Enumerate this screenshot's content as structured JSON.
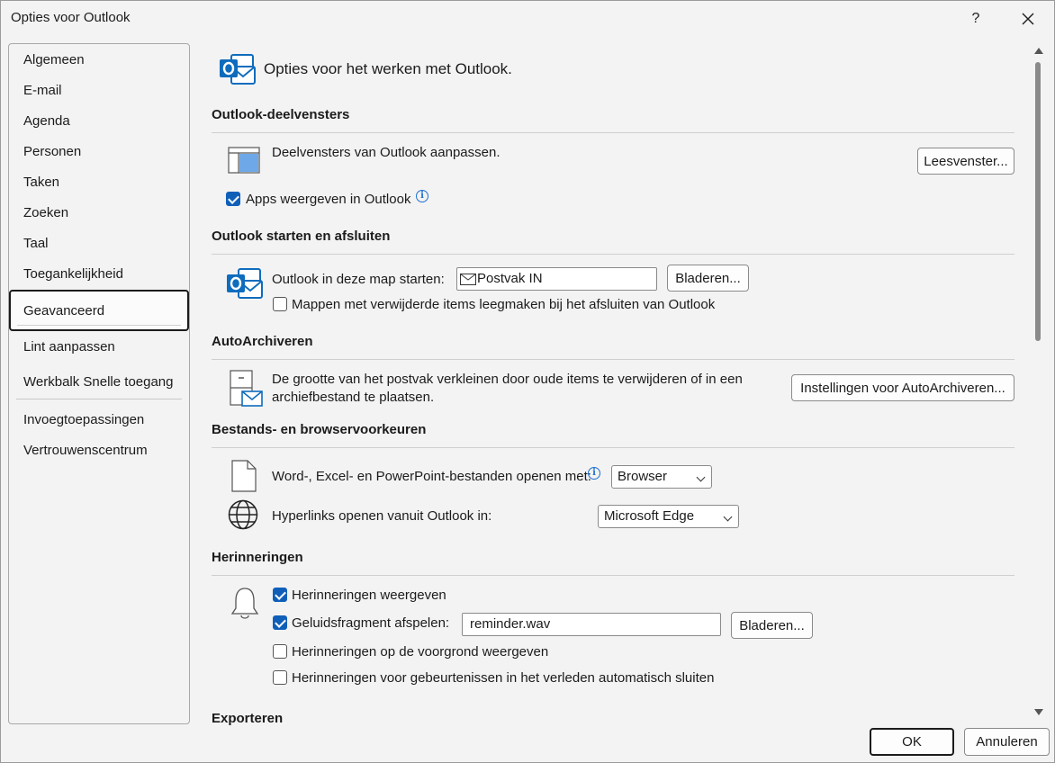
{
  "window": {
    "title": "Opties voor Outlook",
    "help": "?"
  },
  "sidebar": {
    "items": [
      "Algemeen",
      "E-mail",
      "Agenda",
      "Personen",
      "Taken",
      "Zoeken",
      "Taal",
      "Toegankelijkheid",
      "Geavanceerd",
      "Lint aanpassen",
      "Werkbalk Snelle toegang",
      "Invoegtoepassingen",
      "Vertrouwenscentrum"
    ],
    "selected": "Geavanceerd"
  },
  "header": {
    "text": "Opties voor het werken met Outlook."
  },
  "sections": {
    "panes": {
      "title": "Outlook-deelvensters",
      "description": "Deelvensters van Outlook aanpassen.",
      "button": "Leesvenster...",
      "apps_checkbox": "Apps weergeven in Outlook",
      "apps_checked": true
    },
    "start": {
      "title": "Outlook starten en afsluiten",
      "folder_label": "Outlook in deze map starten:",
      "folder_value": "Postvak IN",
      "browse": "Bladeren...",
      "empty_checkbox": "Mappen met verwijderde items leegmaken bij het afsluiten van Outlook",
      "empty_checked": false
    },
    "autoarchive": {
      "title": "AutoArchiveren",
      "description_line1": "De grootte van het postvak verkleinen door oude items te verwijderen of in een",
      "description_line2": "archiefbestand te plaatsen.",
      "button": "Instellingen voor AutoArchiveren..."
    },
    "files": {
      "title": "Bestands- en browservoorkeuren",
      "open_label": "Word-, Excel- en PowerPoint-bestanden openen met:",
      "open_value": "Browser",
      "links_label": "Hyperlinks openen vanuit Outlook in:",
      "links_value": "Microsoft Edge"
    },
    "reminders": {
      "title": "Herinneringen",
      "show": "Herinneringen weergeven",
      "show_checked": true,
      "sound": "Geluidsfragment afspelen:",
      "sound_checked": true,
      "sound_file": "reminder.wav",
      "browse": "Bladeren...",
      "foreground": "Herinneringen op de voorgrond weergeven",
      "foreground_checked": false,
      "autoclose": "Herinneringen voor gebeurtenissen in het verleden automatisch sluiten",
      "autoclose_checked": false
    },
    "export": {
      "title": "Exporteren"
    }
  },
  "footer": {
    "ok": "OK",
    "cancel": "Annuleren"
  },
  "colors": {
    "accent": "#0f5fb9",
    "outlook_blue": "#0f6cbd"
  }
}
